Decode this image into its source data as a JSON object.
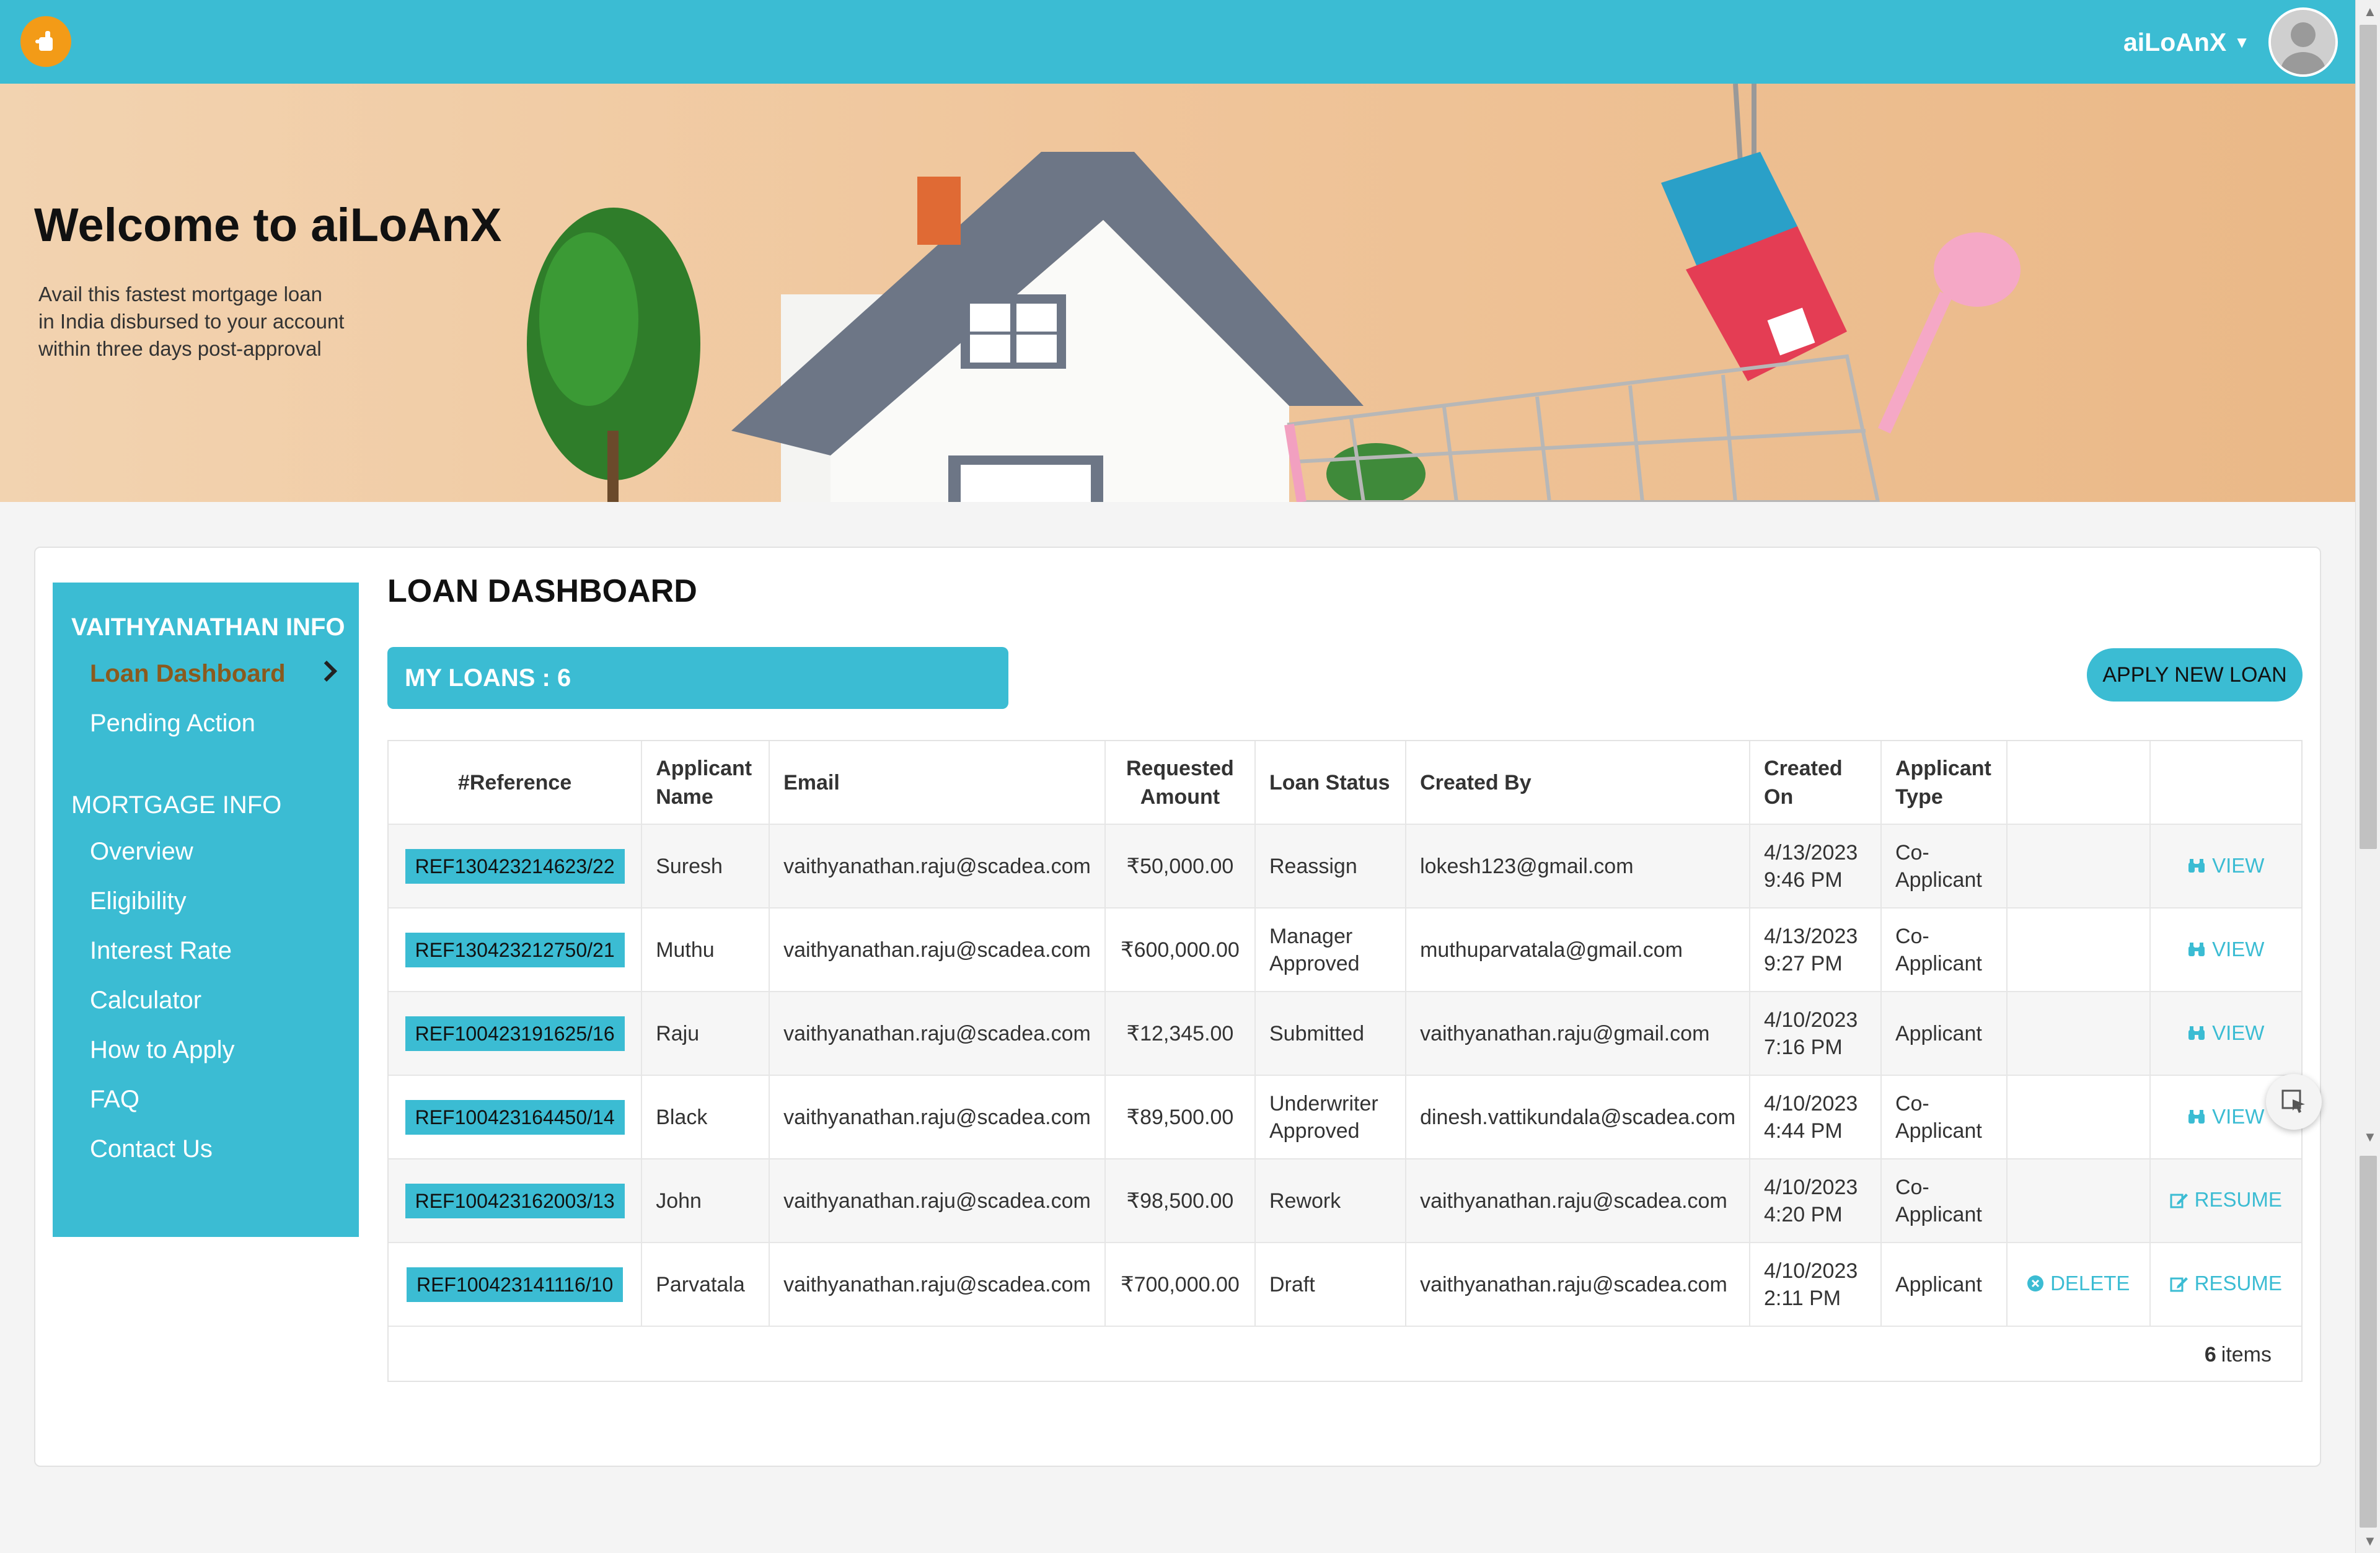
{
  "header": {
    "user_name": "aiLoAnX"
  },
  "hero": {
    "title": "Welcome to aiLoAnX",
    "subtitle_line1": "Avail this fastest mortgage loan",
    "subtitle_line2": "in India disbursed to your account",
    "subtitle_line3": "within three days post-approval"
  },
  "sidebar": {
    "section1": "VAITHYANATHAN INFO",
    "section1_items": [
      "Loan Dashboard",
      "Pending Action"
    ],
    "section2": "MORTGAGE INFO",
    "section2_items": [
      "Overview",
      "Eligibility",
      "Interest Rate",
      "Calculator",
      "How to Apply",
      "FAQ",
      "Contact Us"
    ]
  },
  "main": {
    "title": "LOAN DASHBOARD",
    "my_loans": "MY LOANS : 6",
    "apply_button": "APPLY NEW LOAN"
  },
  "table": {
    "headers": {
      "reference": "#Reference",
      "applicant_name_1": "Applicant",
      "applicant_name_2": "Name",
      "email": "Email",
      "amount_1": "Requested",
      "amount_2": "Amount",
      "status": "Loan Status",
      "created_by": "Created By",
      "created_on_1": "Created",
      "created_on_2": "On",
      "type_1": "Applicant",
      "type_2": "Type"
    },
    "rows": [
      {
        "ref": "REF130423214623/22",
        "name": "Suresh",
        "email": "vaithyanathan.raju@scadea.com",
        "amount": "₹50,000.00",
        "status1": "Reassign",
        "status2": "",
        "created_by": "lokesh123@gmail.com",
        "date": "4/13/2023",
        "time": "9:46 PM",
        "type1": "Co-",
        "type2": "Applicant",
        "delete": "",
        "action": "VIEW"
      },
      {
        "ref": "REF130423212750/21",
        "name": "Muthu",
        "email": "vaithyanathan.raju@scadea.com",
        "amount": "₹600,000.00",
        "status1": "Manager",
        "status2": "Approved",
        "created_by": "muthuparvatala@gmail.com",
        "date": "4/13/2023",
        "time": "9:27 PM",
        "type1": "Co-",
        "type2": "Applicant",
        "delete": "",
        "action": "VIEW"
      },
      {
        "ref": "REF100423191625/16",
        "name": "Raju",
        "email": "vaithyanathan.raju@scadea.com",
        "amount": "₹12,345.00",
        "status1": "Submitted",
        "status2": "",
        "created_by": "vaithyanathan.raju@gmail.com",
        "date": "4/10/2023",
        "time": "7:16 PM",
        "type1": "Applicant",
        "type2": "",
        "delete": "",
        "action": "VIEW"
      },
      {
        "ref": "REF100423164450/14",
        "name": "Black",
        "email": "vaithyanathan.raju@scadea.com",
        "amount": "₹89,500.00",
        "status1": "Underwriter",
        "status2": "Approved",
        "created_by": "dinesh.vattikundala@scadea.com",
        "date": "4/10/2023",
        "time": "4:44 PM",
        "type1": "Co-",
        "type2": "Applicant",
        "delete": "",
        "action": "VIEW"
      },
      {
        "ref": "REF100423162003/13",
        "name": "John",
        "email": "vaithyanathan.raju@scadea.com",
        "amount": "₹98,500.00",
        "status1": "Rework",
        "status2": "",
        "created_by": "vaithyanathan.raju@scadea.com",
        "date": "4/10/2023",
        "time": "4:20 PM",
        "type1": "Co-",
        "type2": "Applicant",
        "delete": "",
        "action": "RESUME"
      },
      {
        "ref": "REF100423141116/10",
        "name": "Parvatala",
        "email": "vaithyanathan.raju@scadea.com",
        "amount": "₹700,000.00",
        "status1": "Draft",
        "status2": "",
        "created_by": "vaithyanathan.raju@scadea.com",
        "date": "4/10/2023",
        "time": "2:11 PM",
        "type1": "Applicant",
        "type2": "",
        "delete": "DELETE",
        "action": "RESUME"
      }
    ],
    "footer_count": "6",
    "footer_label": "items"
  }
}
